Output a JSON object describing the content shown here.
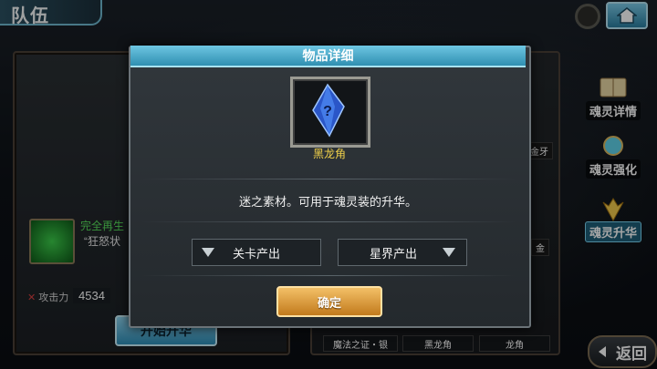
{
  "header": {
    "title": "队伍"
  },
  "side_menu": [
    {
      "label": "魂灵详情",
      "icon": "book-icon",
      "active": false
    },
    {
      "label": "魂灵强化",
      "icon": "orb-icon",
      "active": false
    },
    {
      "label": "魂灵升华",
      "icon": "wings-icon",
      "active": true
    }
  ],
  "left_panel": {
    "skill_name": "完全再生",
    "skill_desc": "“狂怒状",
    "attack_label": "攻击力",
    "attack_value": "4534",
    "upgrade_button": "开始升华"
  },
  "right_panel": {
    "mini_labels": [
      "金牙",
      "金"
    ]
  },
  "bottom_slots": [
    "魔法之证・银",
    "黑龙角",
    "龙角"
  ],
  "back_button": "返回",
  "modal": {
    "title": "物品详细",
    "item_name": "黑龙角",
    "item_description": "迷之素材。可用于魂灵装的升华。",
    "source_left": "关卡产出",
    "source_right": "星界产出",
    "confirm": "确定"
  },
  "colors": {
    "accent_blue": "#2f8fb1",
    "item_name_gold": "#f2d24a",
    "confirm_orange": "#c27a1c",
    "skill_green": "#58e05b"
  }
}
